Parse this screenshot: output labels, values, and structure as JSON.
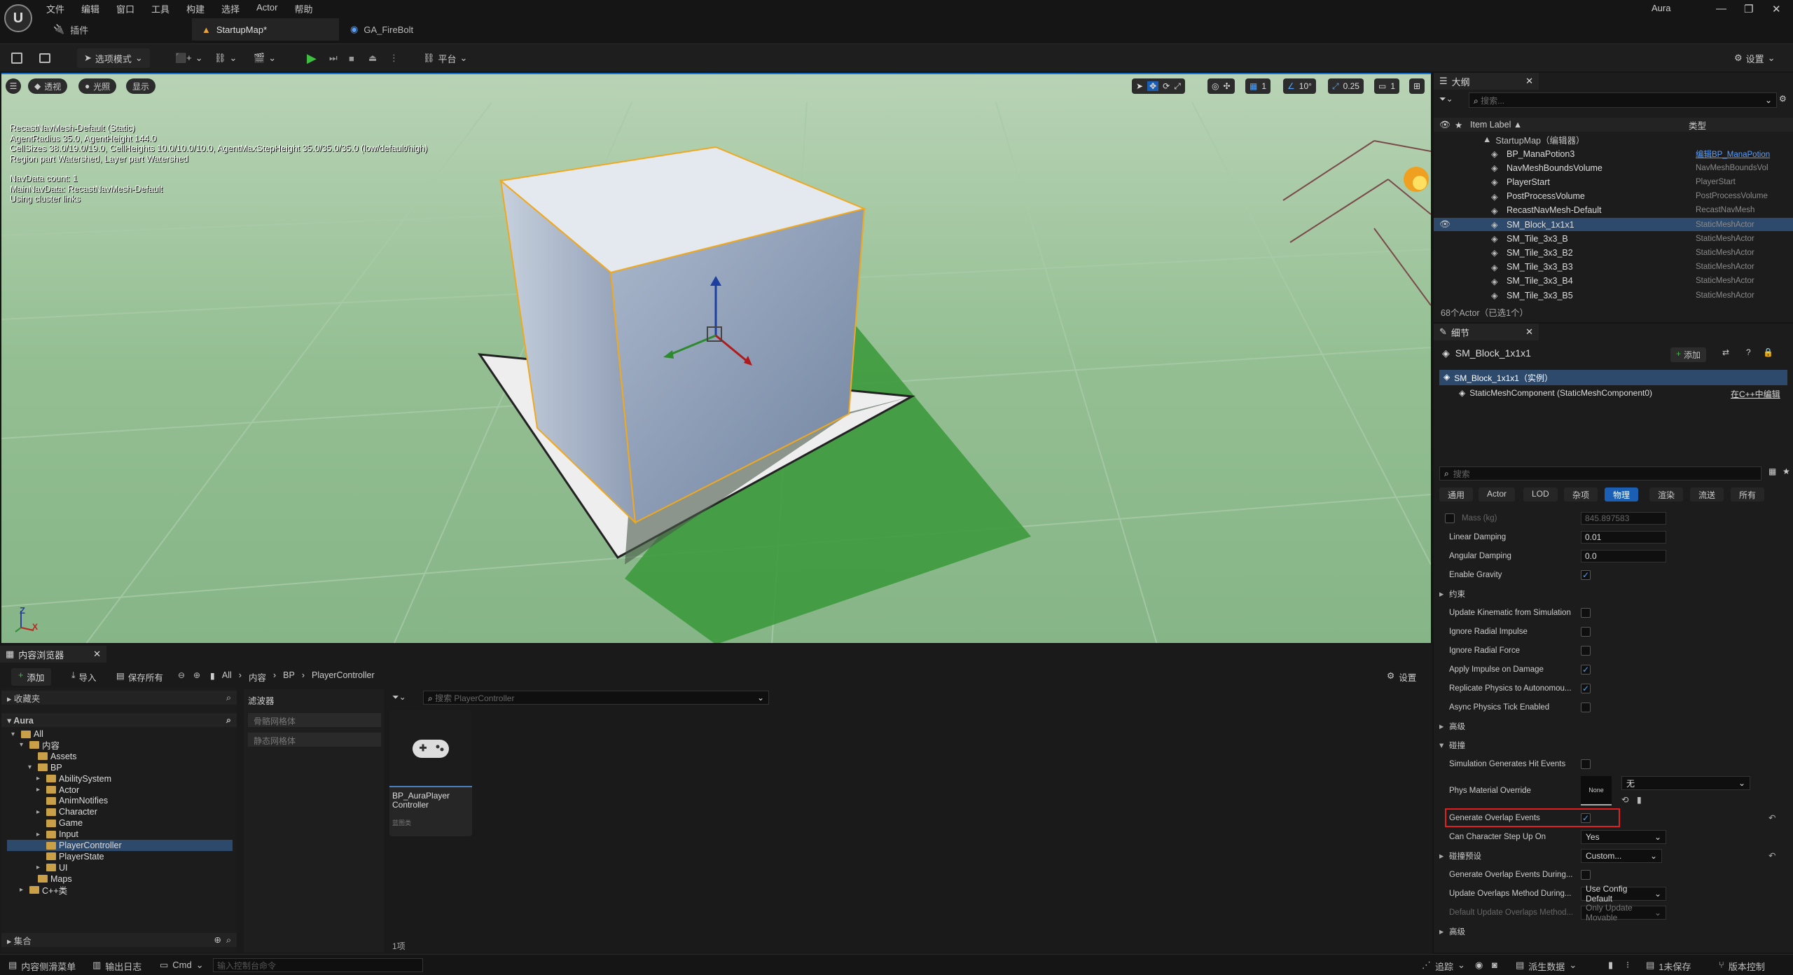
{
  "app": {
    "logo_letter": "U",
    "menu": [
      "文件",
      "编辑",
      "窗口",
      "工具",
      "构建",
      "选择",
      "Actor",
      "帮助"
    ],
    "tabs": [
      {
        "label": "插件",
        "active": false
      },
      {
        "label": "StartupMap*",
        "active": true
      },
      {
        "label": "GA_FireBolt",
        "active": false
      }
    ],
    "project": "Aura",
    "window_controls": [
      "—",
      "❐",
      "✕"
    ]
  },
  "toolbar": {
    "mode_label": "选项模式",
    "platform_label": "平台",
    "settings_label": "设置"
  },
  "viewport": {
    "menu_icon": "hamburger-icon",
    "buttons": [
      "透视",
      "光照",
      "显示"
    ],
    "stats": [
      "RecastNavMesh-Default (Static)",
      "AgentRadius 35.0, AgentHeight 144.0",
      "CellSizes 38.0/19.0/19.0, CellHeights 10.0/10.0/10.0, AgentMaxStepHeight 35.0/35.0/35.0 (low/default/high)",
      "Region part Watershed, Layer part Watershed",
      "",
      "NavData count: 1",
      "MainNavData: RecastNavMesh-Default",
      "Using cluster links"
    ],
    "grid_snap": "1",
    "angle_snap": "10°",
    "scale_snap": "0.25",
    "camera_speed": "1",
    "axis_labels": {
      "z": "Z",
      "x": "X"
    },
    "colors": {
      "ground": "#8fbb8f",
      "selection": "#f0a81e",
      "navmesh": "#3d9a3d"
    }
  },
  "outliner": {
    "title": "大纲",
    "search_placeholder": "搜索...",
    "col_label": "Item Label ▲",
    "col_type": "类型",
    "root": "StartupMap（编辑器）",
    "items": [
      {
        "label": "BP_ManaPotion3",
        "type": "编辑BP_ManaPotion",
        "link": true,
        "selected": false
      },
      {
        "label": "NavMeshBoundsVolume",
        "type": "NavMeshBoundsVol",
        "link": false,
        "selected": false
      },
      {
        "label": "PlayerStart",
        "type": "PlayerStart",
        "link": false,
        "selected": false
      },
      {
        "label": "PostProcessVolume",
        "type": "PostProcessVolume",
        "link": false,
        "selected": false
      },
      {
        "label": "RecastNavMesh-Default",
        "type": "RecastNavMesh",
        "link": false,
        "selected": false
      },
      {
        "label": "SM_Block_1x1x1",
        "type": "StaticMeshActor",
        "link": false,
        "selected": true
      },
      {
        "label": "SM_Tile_3x3_B",
        "type": "StaticMeshActor",
        "link": false,
        "selected": false
      },
      {
        "label": "SM_Tile_3x3_B2",
        "type": "StaticMeshActor",
        "link": false,
        "selected": false
      },
      {
        "label": "SM_Tile_3x3_B3",
        "type": "StaticMeshActor",
        "link": false,
        "selected": false
      },
      {
        "label": "SM_Tile_3x3_B4",
        "type": "StaticMeshActor",
        "link": false,
        "selected": false
      },
      {
        "label": "SM_Tile_3x3_B5",
        "type": "StaticMeshActor",
        "link": false,
        "selected": false
      }
    ],
    "footer": "68个Actor（已选1个）"
  },
  "details": {
    "title": "细节",
    "actor_name": "SM_Block_1x1x1",
    "add_label": "添加",
    "instance_label": "SM_Block_1x1x1（实例）",
    "component_label": "StaticMeshComponent (StaticMeshComponent0)",
    "cpp_edit_label": "在C++中编辑",
    "search_placeholder": "搜索",
    "categories": [
      {
        "label": "通用",
        "on": false
      },
      {
        "label": "Actor",
        "on": false
      },
      {
        "label": "LOD",
        "on": false
      },
      {
        "label": "杂项",
        "on": false
      },
      {
        "label": "物理",
        "on": true
      },
      {
        "label": "渲染",
        "on": false
      },
      {
        "label": "流送",
        "on": false
      },
      {
        "label": "所有",
        "on": false
      }
    ],
    "props": [
      {
        "kind": "value",
        "label": "Mass (kg)",
        "value": "845.897583",
        "dim": true
      },
      {
        "kind": "value",
        "label": "Linear Damping",
        "value": "0.01"
      },
      {
        "kind": "value",
        "label": "Angular Damping",
        "value": "0.0"
      },
      {
        "kind": "check",
        "label": "Enable Gravity",
        "checked": true
      },
      {
        "kind": "section",
        "label": "约束"
      },
      {
        "kind": "check",
        "label": "Update Kinematic from Simulation",
        "checked": false
      },
      {
        "kind": "check",
        "label": "Ignore Radial Impulse",
        "checked": false
      },
      {
        "kind": "check",
        "label": "Ignore Radial Force",
        "checked": false
      },
      {
        "kind": "check",
        "label": "Apply Impulse on Damage",
        "checked": true
      },
      {
        "kind": "check",
        "label": "Replicate Physics to Autonomou...",
        "checked": true
      },
      {
        "kind": "check",
        "label": "Async Physics Tick Enabled",
        "checked": false
      },
      {
        "kind": "section",
        "label": "高级"
      },
      {
        "kind": "open",
        "label": "碰撞"
      },
      {
        "kind": "check",
        "label": "Simulation Generates Hit Events",
        "checked": false
      },
      {
        "kind": "material",
        "label": "Phys Material Override",
        "thumb": "None",
        "dd": "无"
      },
      {
        "kind": "check",
        "label": "Generate Overlap Events",
        "checked": true,
        "highlight": true
      },
      {
        "kind": "dd",
        "label": "Can Character Step Up On",
        "value": "Yes"
      },
      {
        "kind": "ddsec",
        "label": "碰撞预设",
        "value": "Custom..."
      },
      {
        "kind": "check",
        "label": "Generate Overlap Events During...",
        "checked": false
      },
      {
        "kind": "dd",
        "label": "Update Overlaps Method During...",
        "value": "Use Config Default"
      },
      {
        "kind": "dd",
        "label": "Default Update Overlaps Method...",
        "value": "Only Update Movable",
        "dim": true
      },
      {
        "kind": "section",
        "label": "高级"
      }
    ]
  },
  "content_browser": {
    "tab": "内容浏览器",
    "add": "添加",
    "import": "导入",
    "save_all": "保存所有",
    "breadcrumb": [
      "All",
      "内容",
      "BP",
      "PlayerController"
    ],
    "settings": "设置",
    "favorites": "收藏夹",
    "project": "Aura",
    "filters_title": "滤波器",
    "filters": [
      "骨骼网格体",
      "静态网格体"
    ],
    "search_placeholder": "搜索 PlayerController",
    "tree": [
      {
        "label": "All",
        "depth": 0
      },
      {
        "label": "内容",
        "depth": 1
      },
      {
        "label": "Assets",
        "depth": 2
      },
      {
        "label": "BP",
        "depth": 2
      },
      {
        "label": "AbilitySystem",
        "depth": 3
      },
      {
        "label": "Actor",
        "depth": 3
      },
      {
        "label": "AnimNotifies",
        "depth": 3
      },
      {
        "label": "Character",
        "depth": 3
      },
      {
        "label": "Game",
        "depth": 3
      },
      {
        "label": "Input",
        "depth": 3
      },
      {
        "label": "PlayerController",
        "depth": 3,
        "selected": true
      },
      {
        "label": "PlayerState",
        "depth": 3
      },
      {
        "label": "UI",
        "depth": 3
      },
      {
        "label": "Maps",
        "depth": 2
      },
      {
        "label": "C++类",
        "depth": 1
      }
    ],
    "collections": "集合",
    "asset": {
      "name": "BP_AuraPlayer Controller",
      "type": "蓝图类"
    },
    "count": "1项"
  },
  "statusbar": {
    "drawer": "内容侧滑菜单",
    "output": "输出日志",
    "cmd": "Cmd",
    "cmd_placeholder": "输入控制台命令",
    "trace": "追踪",
    "derived": "派生数据",
    "unsaved": "1未保存",
    "source": "版本控制"
  }
}
